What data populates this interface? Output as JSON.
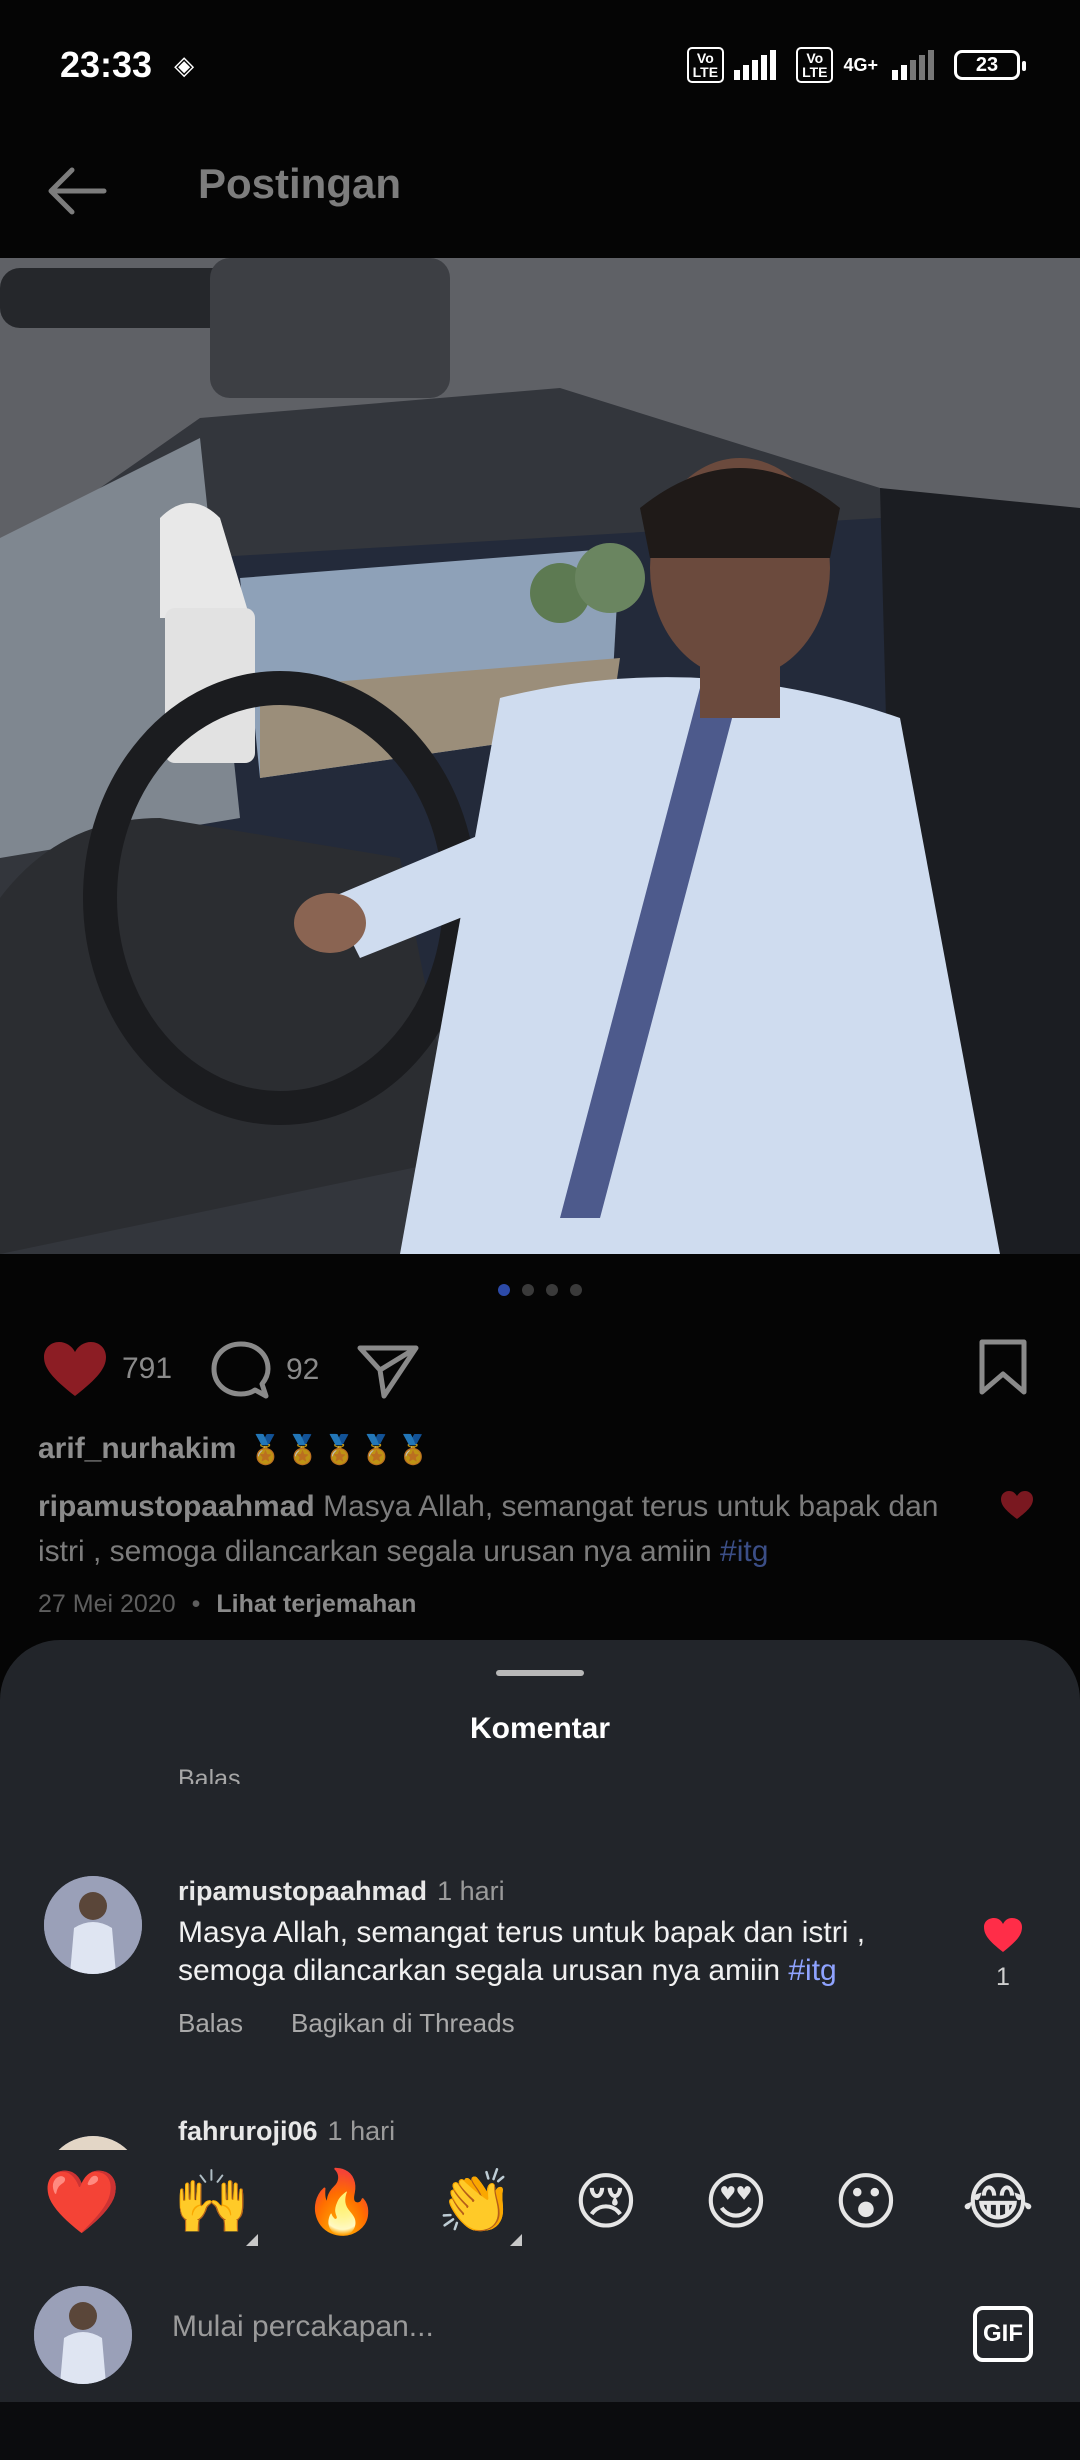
{
  "status_bar": {
    "time": "23:33",
    "volte_1": "Vo\nLTE",
    "volte_2": "Vo\nLTE",
    "network": "4G+",
    "battery": "23"
  },
  "header": {
    "title": "Postingan"
  },
  "post": {
    "likes": "791",
    "comments": "92",
    "owner": "arif_nurhakim",
    "owner_badges": "🏅🏅🏅🏅🏅",
    "caption_user": "ripamustopaahmad",
    "caption_text": " Masya Allah, semangat terus untuk bapak dan istri , semoga dilancarkan segala urusan nya amiin ",
    "caption_tag": "#itg",
    "date": "27 Mei 2020",
    "separator": "•",
    "translate": "Lihat terjemahan"
  },
  "comments_sheet": {
    "title": "Komentar",
    "partial_reply": "Balas",
    "comments": [
      {
        "username": "ripamustopaahmad",
        "time": "1 hari",
        "text": "Masya Allah, semangat terus untuk bapak dan istri , semoga dilancarkan segala urusan nya amiin ",
        "tag": "#itg",
        "reply": "Balas",
        "share": "Bagikan di Threads",
        "likes": "1"
      },
      {
        "username": "fahruroji06",
        "time": "1 hari"
      }
    ]
  },
  "emoji_bar": {
    "items": [
      "❤️",
      "🙌",
      "🔥",
      "👏",
      "😢",
      "😍",
      "😮",
      "😂"
    ]
  },
  "composer": {
    "placeholder": "Mulai percakapan...",
    "gif_label": "GIF"
  }
}
